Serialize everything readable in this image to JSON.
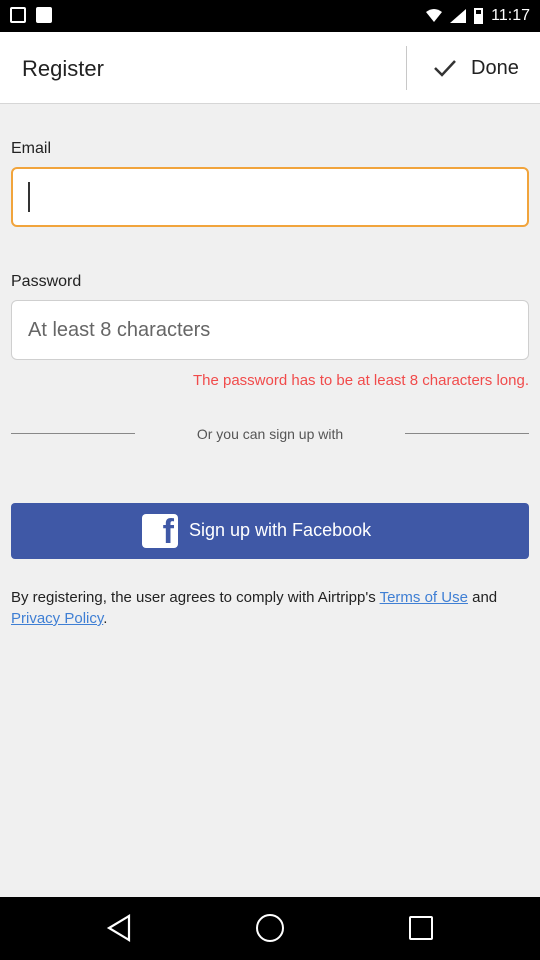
{
  "status_bar": {
    "time": "11:17",
    "icons": [
      "notification-icon",
      "notification-icon",
      "wifi-icon",
      "signal-icon",
      "battery-icon"
    ]
  },
  "action_bar": {
    "title": "Register",
    "done_label": "Done",
    "done_icon": "check-icon"
  },
  "form": {
    "email_label": "Email",
    "email_value": "",
    "password_label": "Password",
    "password_placeholder": "At least 8 characters",
    "password_error": "The password has to be at least 8 characters long.",
    "or_text": "Or you can sign up with"
  },
  "facebook": {
    "label": "Sign up with Facebook",
    "icon": "facebook-icon",
    "color": "#3f58a6"
  },
  "terms": {
    "prefix": "By registering, the user agrees to comply with Airtripp's ",
    "terms_link": "Terms of Use",
    "middle": " and ",
    "privacy_link": "Privacy Policy",
    "suffix": "."
  },
  "colors": {
    "focus_border": "#f1a43c",
    "error": "#f14b4b",
    "link": "#3f7fd4"
  },
  "nav_bar": {
    "icons": [
      "back-icon",
      "home-icon",
      "recent-apps-icon"
    ]
  }
}
